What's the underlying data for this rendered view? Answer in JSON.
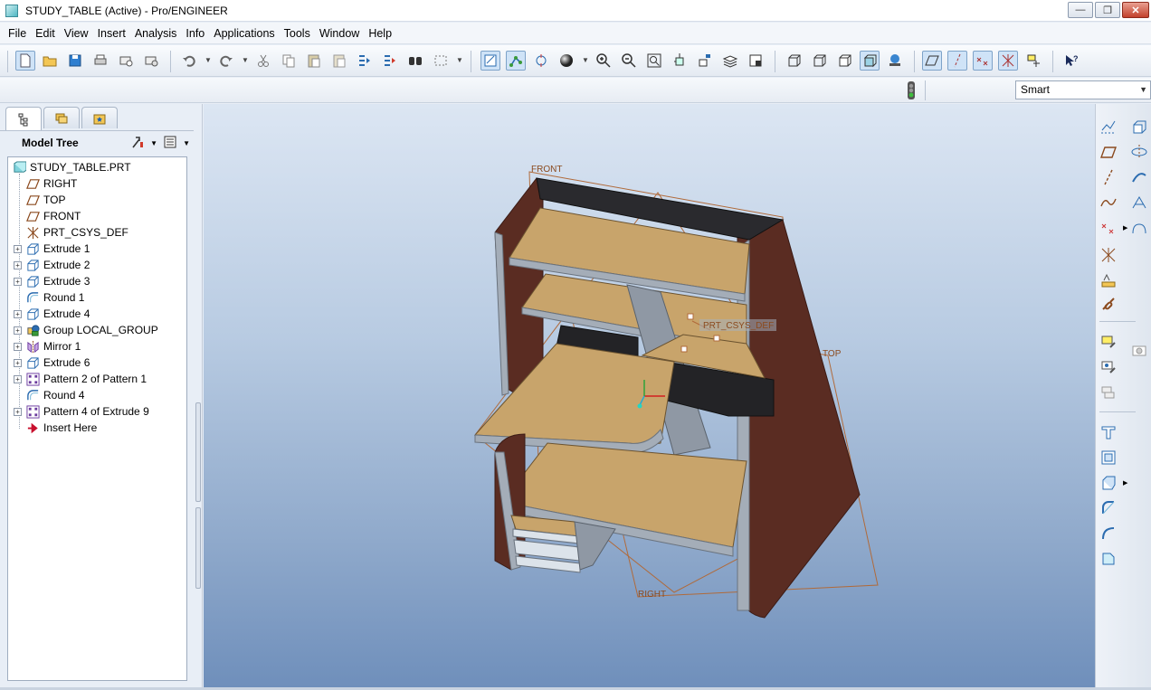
{
  "window": {
    "title": "STUDY_TABLE (Active) - Pro/ENGINEER",
    "minimize": "—",
    "maximize": "❐",
    "close": "✕"
  },
  "menu": [
    "File",
    "Edit",
    "View",
    "Insert",
    "Analysis",
    "Info",
    "Applications",
    "Tools",
    "Window",
    "Help"
  ],
  "filter": {
    "value": "Smart"
  },
  "navigator": {
    "title": "Model Tree",
    "tree": [
      {
        "label": "STUDY_TABLE.PRT",
        "icon": "part-icon",
        "expandable": false,
        "level": 0
      },
      {
        "label": "RIGHT",
        "icon": "datum-plane-icon",
        "expandable": false,
        "level": 1
      },
      {
        "label": "TOP",
        "icon": "datum-plane-icon",
        "expandable": false,
        "level": 1
      },
      {
        "label": "FRONT",
        "icon": "datum-plane-icon",
        "expandable": false,
        "level": 1
      },
      {
        "label": "PRT_CSYS_DEF",
        "icon": "csys-icon",
        "expandable": false,
        "level": 1
      },
      {
        "label": "Extrude 1",
        "icon": "extrude-icon",
        "expandable": true,
        "level": 1
      },
      {
        "label": "Extrude 2",
        "icon": "extrude-icon",
        "expandable": true,
        "level": 1
      },
      {
        "label": "Extrude 3",
        "icon": "extrude-icon",
        "expandable": true,
        "level": 1
      },
      {
        "label": "Round 1",
        "icon": "round-icon",
        "expandable": false,
        "level": 1
      },
      {
        "label": "Extrude 4",
        "icon": "extrude-icon",
        "expandable": true,
        "level": 1
      },
      {
        "label": "Group LOCAL_GROUP",
        "icon": "group-icon",
        "expandable": true,
        "level": 1
      },
      {
        "label": "Mirror 1",
        "icon": "mirror-icon",
        "expandable": true,
        "level": 1
      },
      {
        "label": "Extrude 6",
        "icon": "extrude-icon",
        "expandable": true,
        "level": 1
      },
      {
        "label": "Pattern 2 of Pattern 1",
        "icon": "pattern-icon",
        "expandable": true,
        "level": 1
      },
      {
        "label": "Round 4",
        "icon": "round-icon",
        "expandable": false,
        "level": 1
      },
      {
        "label": "Pattern 4 of Extrude 9",
        "icon": "pattern-icon",
        "expandable": true,
        "level": 1
      },
      {
        "label": "Insert Here",
        "icon": "insert-here-arrow-icon",
        "expandable": false,
        "level": 1
      }
    ]
  },
  "viewport": {
    "labels": {
      "front": "FRONT",
      "top": "TOP",
      "right": "RIGHT",
      "csys": "PRT_CSYS_DEF"
    },
    "colors": {
      "wood": "#c8a46b",
      "panel": "#5a2c22",
      "plane": "#b06a3a"
    }
  }
}
